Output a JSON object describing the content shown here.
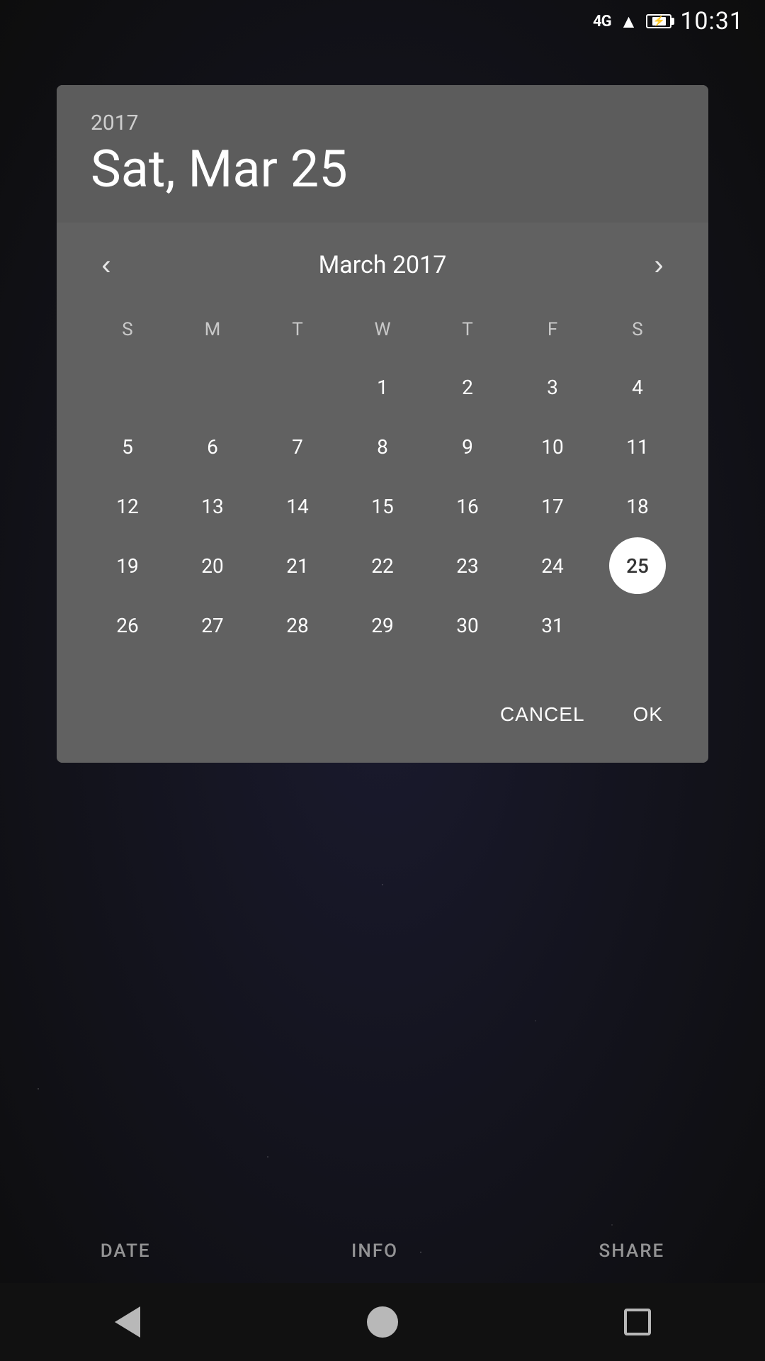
{
  "statusBar": {
    "signal": "4G",
    "time": "10:31"
  },
  "dialog": {
    "year": "2017",
    "selectedDateLabel": "Sat, Mar 25",
    "monthTitle": "March 2017",
    "prevBtn": "‹",
    "nextBtn": "›",
    "dayHeaders": [
      "S",
      "M",
      "T",
      "W",
      "T",
      "F",
      "S"
    ],
    "selectedDay": 25,
    "weeks": [
      [
        null,
        null,
        null,
        1,
        2,
        3,
        4
      ],
      [
        5,
        6,
        7,
        8,
        9,
        10,
        11
      ],
      [
        12,
        13,
        14,
        15,
        16,
        17,
        18
      ],
      [
        19,
        20,
        21,
        22,
        23,
        24,
        25
      ],
      [
        26,
        27,
        28,
        29,
        30,
        31,
        null
      ]
    ],
    "cancelLabel": "CANCEL",
    "okLabel": "OK"
  },
  "bottomTabs": {
    "date": "DATE",
    "info": "INFO",
    "share": "SHARE"
  },
  "navBar": {
    "back": "◀",
    "home": "●",
    "recent": "■"
  }
}
